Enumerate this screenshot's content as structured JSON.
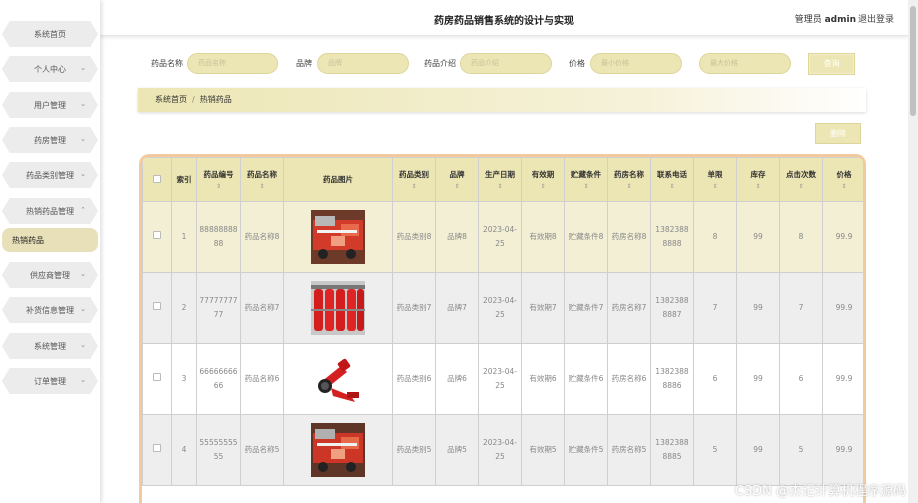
{
  "header": {
    "title": "药房药品销售系统的设计与实现",
    "user_label": "管理员 ",
    "user_name": "admin",
    "logout": "退出登录"
  },
  "sidebar": {
    "items": [
      {
        "label": "系统首页",
        "has_chevron": false
      },
      {
        "label": "个人中心",
        "has_chevron": true
      },
      {
        "label": "用户管理",
        "has_chevron": true
      },
      {
        "label": "药房管理",
        "has_chevron": true
      },
      {
        "label": "药品类别管理",
        "has_chevron": true
      },
      {
        "label": "热销药品管理",
        "has_chevron": true,
        "expanded": true
      },
      {
        "label": "热销药品",
        "sub": true
      },
      {
        "label": "供应商管理",
        "has_chevron": true
      },
      {
        "label": "补货信息管理",
        "has_chevron": true
      },
      {
        "label": "系统管理",
        "has_chevron": true
      },
      {
        "label": "订单管理",
        "has_chevron": true
      }
    ]
  },
  "search": {
    "name_label": "药品名称",
    "name_placeholder": "药品名称",
    "brand_label": "品牌",
    "brand_placeholder": "品牌",
    "intro_label": "药品介绍",
    "intro_placeholder": "药品介绍",
    "price_label": "价格",
    "price_min_placeholder": "最小价格",
    "price_max_placeholder": "最大价格",
    "query_button": "查询"
  },
  "breadcrumb": {
    "home": "系统首页",
    "separator": "/",
    "current": "热销药品"
  },
  "toolbar": {
    "delete_button": "删除"
  },
  "table": {
    "headers": [
      "索引",
      "药品编号",
      "药品名称",
      "药品图片",
      "药品类别",
      "品牌",
      "生产日期",
      "有效期",
      "贮藏条件",
      "药房名称",
      "联系电话",
      "单限",
      "库存",
      "点击次数",
      "价格"
    ],
    "sort_glyph": "⇕",
    "rows": [
      {
        "index": "1",
        "code": "8888888888",
        "name": "药品名称8",
        "category": "药品类别8",
        "brand": "品牌8",
        "date": "2023-04-25",
        "validity": "有效期8",
        "storage": "贮藏条件8",
        "pharmacy": "药房名称8",
        "phone": "13823888888",
        "limit": "8",
        "stock": "99",
        "clicks": "8",
        "price": "99.9"
      },
      {
        "index": "2",
        "code": "7777777777",
        "name": "药品名称7",
        "category": "药品类别7",
        "brand": "品牌7",
        "date": "2023-04-25",
        "validity": "有效期7",
        "storage": "贮藏条件7",
        "pharmacy": "药房名称7",
        "phone": "13823888887",
        "limit": "7",
        "stock": "99",
        "clicks": "7",
        "price": "99.9"
      },
      {
        "index": "3",
        "code": "6666666666",
        "name": "药品名称6",
        "category": "药品类别6",
        "brand": "品牌6",
        "date": "2023-04-25",
        "validity": "有效期6",
        "storage": "贮藏条件6",
        "pharmacy": "药房名称6",
        "phone": "13823888886",
        "limit": "6",
        "stock": "99",
        "clicks": "6",
        "price": "99.9"
      },
      {
        "index": "4",
        "code": "5555555555",
        "name": "药品名称5",
        "category": "药品类别5",
        "brand": "品牌5",
        "date": "2023-04-25",
        "validity": "有效期5",
        "storage": "贮藏条件5",
        "pharmacy": "药房名称5",
        "phone": "13823888885",
        "limit": "5",
        "stock": "99",
        "clicks": "5",
        "price": "99.9"
      }
    ]
  },
  "watermark": "CSDN @杰记计算机程序源码",
  "colors": {
    "accent": "#ece6b4",
    "accent_border": "#ddd59a",
    "table_frame": "#f3caa0",
    "row_highlight": "#f2efd5",
    "row_gray": "#eeeeee"
  }
}
